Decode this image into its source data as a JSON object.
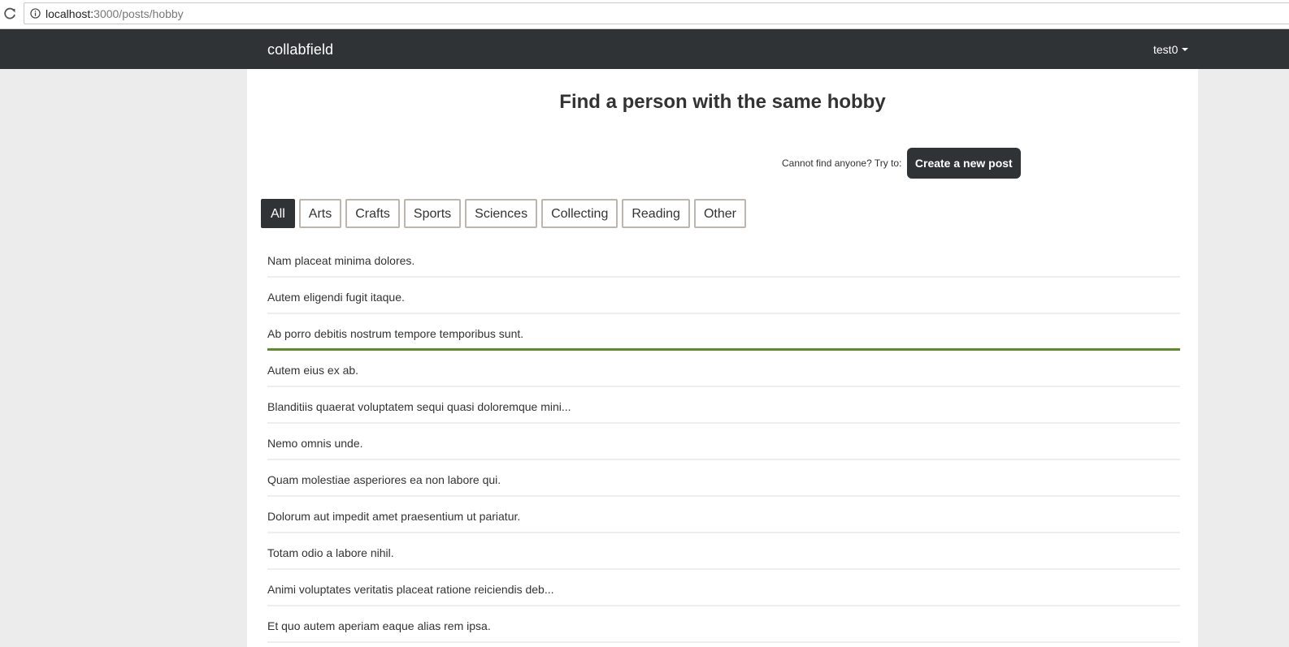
{
  "browser": {
    "url_host": "localhost:",
    "url_path": "3000/posts/hobby",
    "reload_icon": "reload-icon",
    "info_icon": "info-icon"
  },
  "navbar": {
    "brand": "collabfield",
    "user": "test0",
    "background": "#303336"
  },
  "main": {
    "title": "Find a person with the same hobby",
    "cta_text": "Cannot find anyone? Try to:",
    "create_button": "Create a new post"
  },
  "tabs": [
    {
      "label": "All",
      "active": true
    },
    {
      "label": "Arts",
      "active": false
    },
    {
      "label": "Crafts",
      "active": false
    },
    {
      "label": "Sports",
      "active": false
    },
    {
      "label": "Sciences",
      "active": false
    },
    {
      "label": "Collecting",
      "active": false
    },
    {
      "label": "Reading",
      "active": false
    },
    {
      "label": "Other",
      "active": false
    }
  ],
  "posts": [
    {
      "title": "Nam placeat minima dolores."
    },
    {
      "title": "Autem eligendi fugit itaque."
    },
    {
      "title": "Ab porro debitis nostrum tempore temporibus sunt.",
      "highlighted": true
    },
    {
      "title": "Autem eius ex ab."
    },
    {
      "title": "Blanditiis quaerat voluptatem sequi quasi doloremque mini..."
    },
    {
      "title": "Nemo omnis unde."
    },
    {
      "title": "Quam molestiae asperiores ea non labore qui."
    },
    {
      "title": "Dolorum aut impedit amet praesentium ut pariatur."
    },
    {
      "title": "Totam odio a labore nihil."
    },
    {
      "title": "Animi voluptates veritatis placeat ratione reiciendis deb..."
    },
    {
      "title": "Et quo autem aperiam eaque alias rem ipsa."
    }
  ],
  "colors": {
    "accent_dark": "#303336",
    "hover_line": "#5f8b2b",
    "tab_border": "#bdb6ae"
  }
}
